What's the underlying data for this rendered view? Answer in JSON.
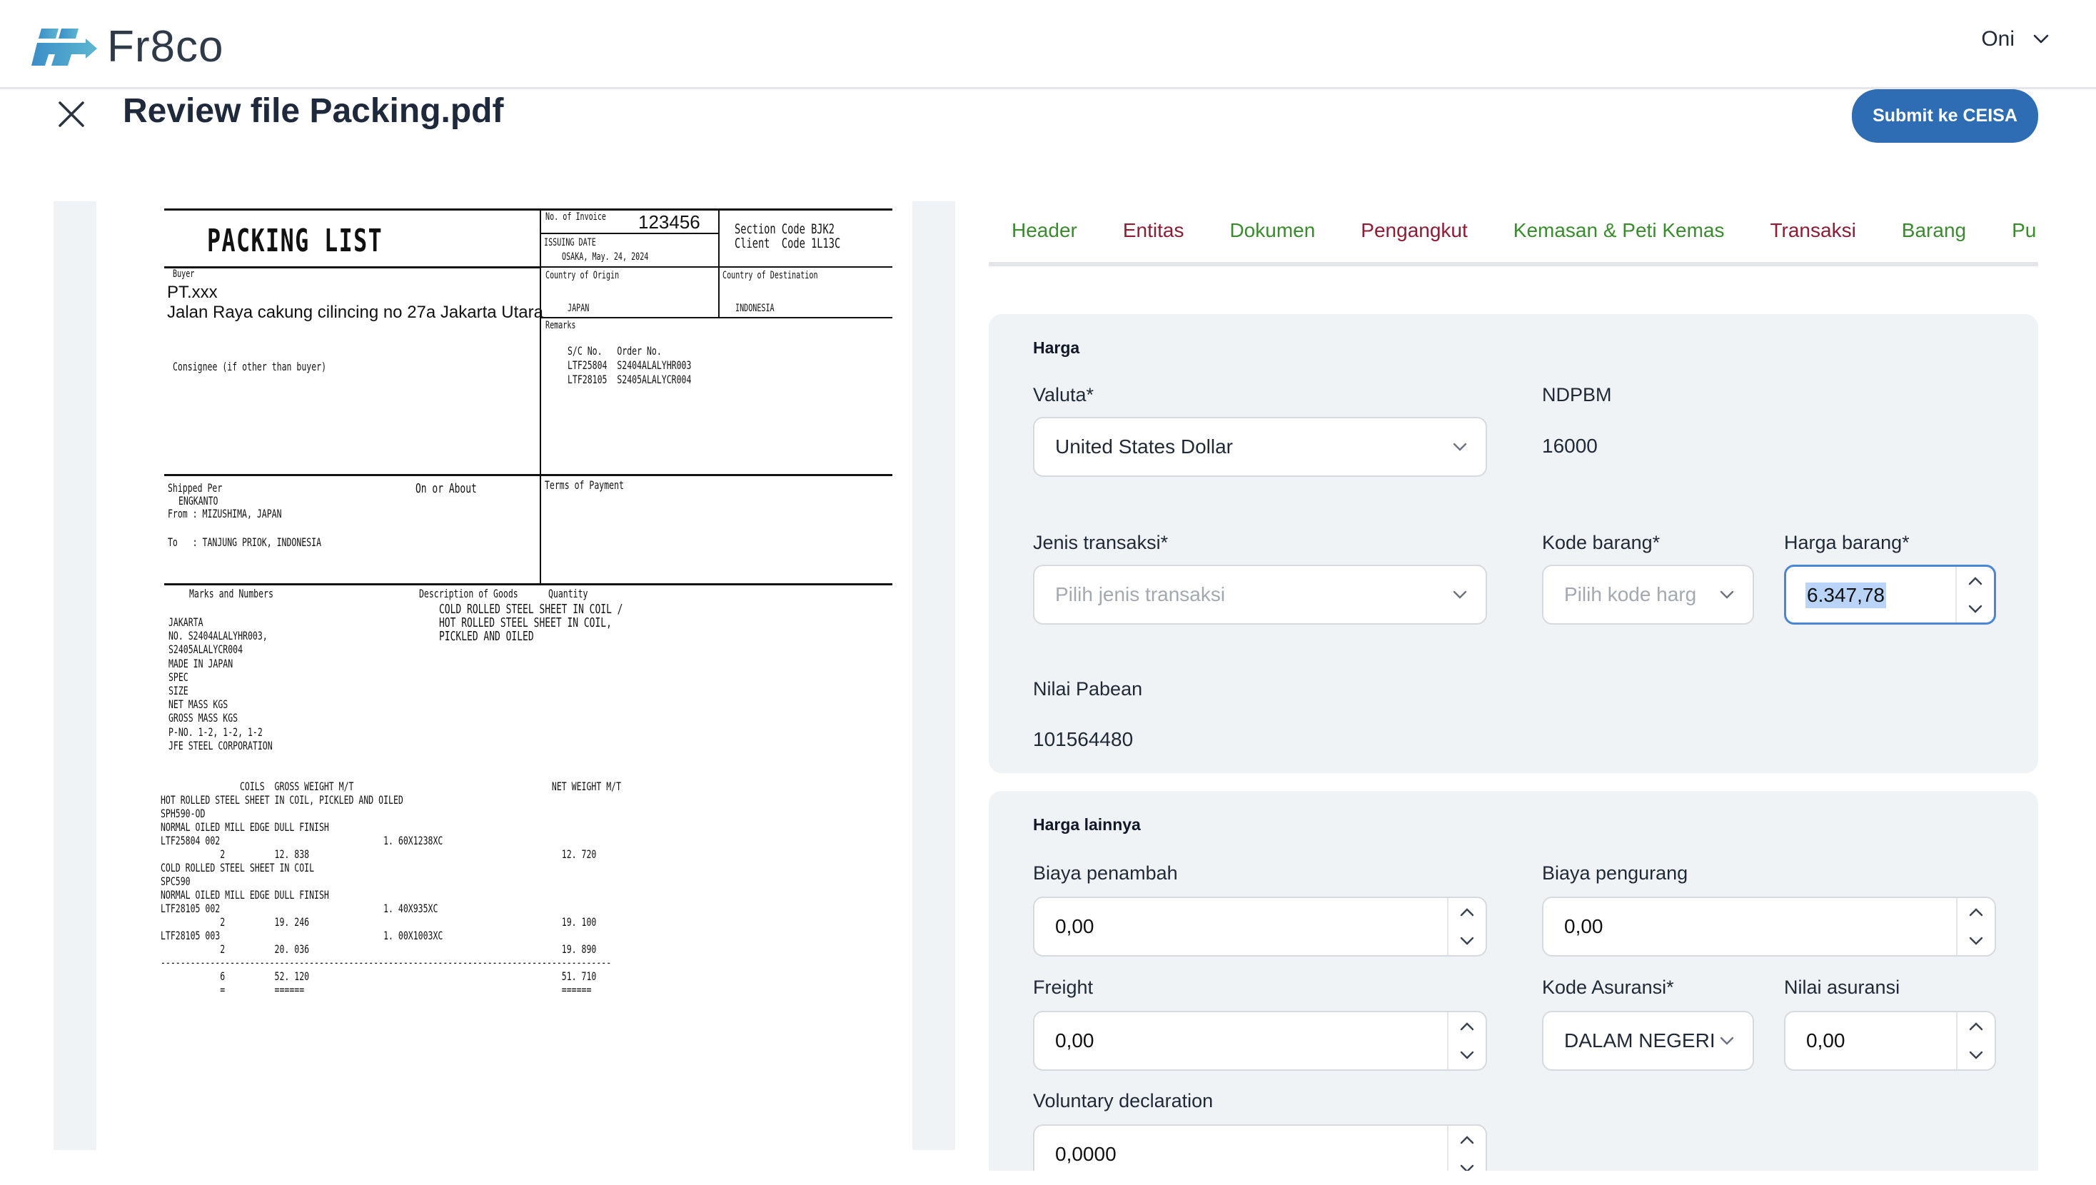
{
  "app": {
    "brand": "Fr8co",
    "brand_colors": {
      "logo_start": "#3b8ec8",
      "logo_end": "#5cb6cf",
      "text": "#2f3a48"
    },
    "user": {
      "name": "Oni",
      "icon": "chevron-down-icon"
    }
  },
  "page": {
    "title": "Review file Packing.pdf",
    "close_icon": "close-icon",
    "submit_label": "Submit ke CEISA",
    "submit_color": "#2e6db4"
  },
  "tabs": [
    {
      "label": "Header",
      "status": "complete",
      "color": "#3a8a2e"
    },
    {
      "label": "Entitas",
      "status": "incomplete",
      "color": "#8b1e35"
    },
    {
      "label": "Dokumen",
      "status": "complete",
      "color": "#3a8a2e"
    },
    {
      "label": "Pengangkut",
      "status": "incomplete",
      "color": "#8b1e35"
    },
    {
      "label": "Kemasan & Peti Kemas",
      "status": "complete",
      "color": "#3a8a2e"
    },
    {
      "label": "Transaksi",
      "status": "incomplete",
      "active": true,
      "color": "#8b1e35"
    },
    {
      "label": "Barang",
      "status": "complete",
      "color": "#3a8a2e"
    },
    {
      "label": "Pu",
      "status": "complete",
      "color": "#3a8a2e"
    }
  ],
  "harga": {
    "title": "Harga",
    "valuta": {
      "label": "Valuta*",
      "value": "United States Dollar"
    },
    "ndpbm": {
      "label": "NDPBM",
      "value": "16000"
    },
    "jenis_transaksi": {
      "label": "Jenis transaksi*",
      "placeholder": "Pilih jenis transaksi"
    },
    "kode_barang": {
      "label": "Kode barang*",
      "placeholder": "Pilih kode harg"
    },
    "harga_barang": {
      "label": "Harga barang*",
      "value": "6.347,78"
    },
    "nilai_pabean": {
      "label": "Nilai Pabean",
      "value": "101564480"
    }
  },
  "harga_lainnya": {
    "title": "Harga lainnya",
    "biaya_penambah": {
      "label": "Biaya penambah",
      "value": "0,00"
    },
    "biaya_pengurang": {
      "label": "Biaya pengurang",
      "value": "0,00"
    },
    "freight": {
      "label": "Freight",
      "value": "0,00"
    },
    "kode_asuransi": {
      "label": "Kode Asuransi*",
      "value": "DALAM NEGERI"
    },
    "nilai_asuransi": {
      "label": "Nilai asuransi",
      "value": "0,00"
    },
    "voluntary_declaration": {
      "label": "Voluntary declaration",
      "value": "0,0000"
    }
  },
  "document": {
    "title": "PACKING LIST",
    "invoice_label": "No. of Invoice",
    "invoice_no": "123456",
    "issuing_date_label": "ISSUING DATE",
    "issuing_date": "OSAKA, May. 24, 2024",
    "section_code": "Section Code BJK2",
    "client_code": "Client  Code 1L13C",
    "buyer_label": "Buyer",
    "buyer_name": "PT.xxx",
    "buyer_address": "Jalan Raya cakung cilincing no 27a Jakarta Utara",
    "consignee_label": "Consignee (if other than buyer)",
    "origin_label": "Country of Origin",
    "origin": "JAPAN",
    "destination_label": "Country of Destination",
    "destination": "INDONESIA",
    "remarks_label": "Remarks",
    "remarks": "S/C No.   Order No.\nLTF25804  S2404ALALYHR003\nLTF28105  S2405ALALYCR004",
    "shipped_per_label": "Shipped Per",
    "vessel": "ENGKANTO",
    "from": "From : MIZUSHIMA, JAPAN",
    "to": "To   : TANJUNG PRIOK, INDONESIA",
    "on_or_about_label": "On or About",
    "terms_label": "Terms of Payment",
    "marks_label": "Marks and Numbers",
    "desc_label": "Description of Goods",
    "qty_label": "Quantity",
    "marks": "JAKARTA\nNO. S2404ALALYHR003,\nS2405ALALYCR004\nMADE IN JAPAN\nSPEC\nSIZE\nNET MASS KGS\nGROSS MASS KGS\nP-NO. 1-2, 1-2, 1-2\nJFE STEEL CORPORATION",
    "description": "COLD ROLLED STEEL SHEET IN COIL /\nHOT ROLLED STEEL SHEET IN COIL,\nPICKLED AND OILED",
    "detail_header": "                COILS  GROSS WEIGHT M/T                                        NET WEIGHT M/T",
    "detail_lines": "HOT ROLLED STEEL SHEET IN COIL, PICKLED AND OILED\nSPH590-OD\nNORMAL OILED MILL EDGE DULL FINISH\nLTF25804 002                                 1. 60X1238XC\n            2          12. 838                                                   12. 720\nCOLD ROLLED STEEL SHEET IN COIL\nSPC590\nNORMAL OILED MILL EDGE DULL FINISH\nLTF28105 002                                 1. 40X935XC\n            2          19. 246                                                   19. 100\nLTF28105 003                                 1. 00X1003XC\n            2          20. 036                                                   19. 890\n-------------------------------------------------------------------------------------------\n            6          52. 120                                                   51. 710\n            =          ======                                                    ======"
  }
}
